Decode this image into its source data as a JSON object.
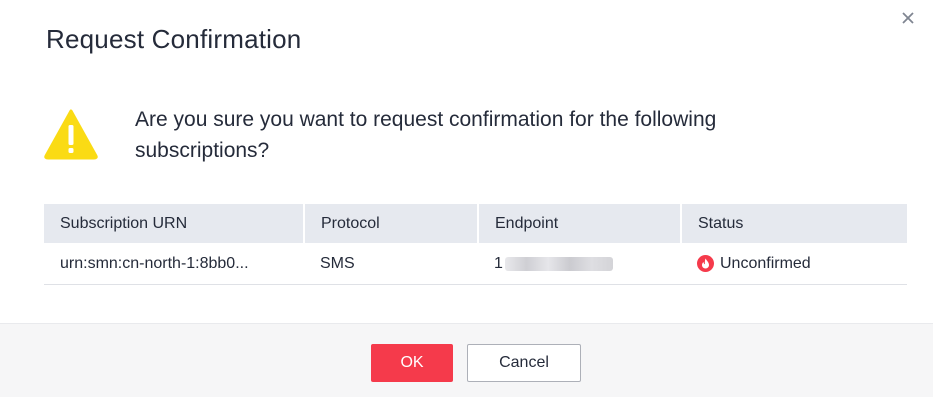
{
  "dialog": {
    "title": "Request Confirmation",
    "close_icon": "close-icon",
    "message": "Are you sure you want to request confirmation for the following subscriptions?",
    "warning_icon": "warning-icon",
    "colors": {
      "primary": "#f53a4b",
      "warning": "#fadb14",
      "header_bg": "#e6e9ef",
      "footer_bg": "#f6f6f7"
    }
  },
  "table": {
    "headers": [
      "Subscription URN",
      "Protocol",
      "Endpoint",
      "Status"
    ],
    "rows": [
      {
        "urn": "urn:smn:cn-north-1:8bb0...",
        "protocol": "SMS",
        "endpoint": "1",
        "status": "Unconfirmed",
        "status_icon": "unconfirmed-status-icon"
      }
    ]
  },
  "footer": {
    "ok_label": "OK",
    "cancel_label": "Cancel"
  }
}
